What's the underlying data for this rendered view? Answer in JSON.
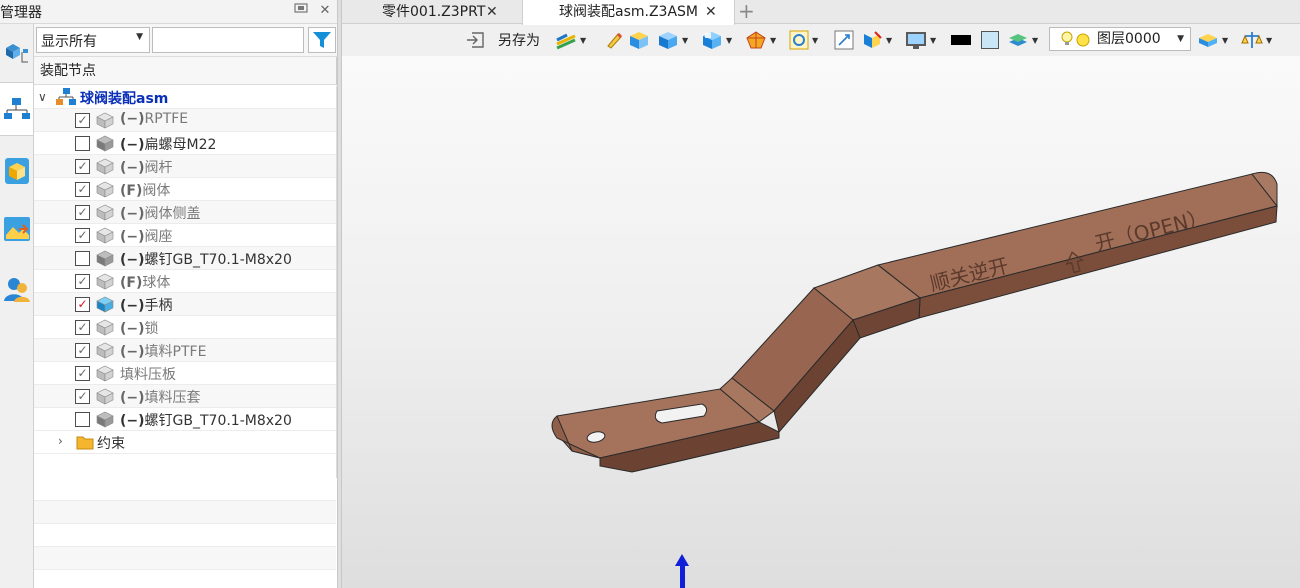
{
  "manager": {
    "title": "管理器",
    "pin_icon": "pin-icon",
    "close_icon": "close-icon"
  },
  "side_tabs": [
    "assembly-manager-icon",
    "history-tree-icon",
    "part-view-icon",
    "image-view-icon",
    "user-roles-icon"
  ],
  "filter": {
    "selected": "显示所有",
    "search_value": "",
    "filter_icon": "funnel-icon"
  },
  "tree": {
    "column_header": "装配节点",
    "root_label": "球阀装配asm",
    "items": [
      {
        "checked": true,
        "prefix": "(−)",
        "name": "RPTFE",
        "dim": true,
        "icon_dark": false
      },
      {
        "checked": false,
        "prefix": "(−)",
        "name": "扁螺母M22",
        "dim": false,
        "icon_dark": true
      },
      {
        "checked": true,
        "prefix": "(−)",
        "name": "阀杆",
        "dim": true,
        "icon_dark": false
      },
      {
        "checked": true,
        "prefix": "(F)",
        "name": "阀体",
        "dim": true,
        "icon_dark": false
      },
      {
        "checked": true,
        "prefix": "(−)",
        "name": "阀体侧盖",
        "dim": true,
        "icon_dark": false
      },
      {
        "checked": true,
        "prefix": "(−)",
        "name": "阀座",
        "dim": true,
        "icon_dark": false
      },
      {
        "checked": false,
        "prefix": "(−)",
        "name": "螺钉GB_T70.1-M8x20",
        "dim": false,
        "icon_dark": true
      },
      {
        "checked": true,
        "prefix": "(F)",
        "name": "球体",
        "dim": true,
        "icon_dark": false
      },
      {
        "checked": true,
        "prefix": "(−)",
        "name": "手柄",
        "dim": false,
        "icon_dark": false,
        "active": true
      },
      {
        "checked": true,
        "prefix": "(−)",
        "name": "锁",
        "dim": true,
        "icon_dark": false
      },
      {
        "checked": true,
        "prefix": "(−)",
        "name": "填料PTFE",
        "dim": true,
        "icon_dark": false
      },
      {
        "checked": true,
        "prefix": "",
        "name": "填料压板",
        "dim": true,
        "icon_dark": false
      },
      {
        "checked": true,
        "prefix": "(−)",
        "name": "填料压套",
        "dim": true,
        "icon_dark": false
      },
      {
        "checked": false,
        "prefix": "(−)",
        "name": "螺钉GB_T70.1-M8x20",
        "dim": false,
        "icon_dark": true
      }
    ],
    "constraints_label": "约束"
  },
  "doc_tabs": [
    {
      "label": "零件001.Z3PRT",
      "active": false
    },
    {
      "label": "球阀装配asm.Z3ASM",
      "active": true
    }
  ],
  "toolbar": {
    "save_as_label": "另存为",
    "layer_label": "图层0000",
    "icons": [
      "import-icon",
      "render-mode-icon",
      "pen-icon",
      "solid-view-icon",
      "view-cube-icon",
      "section-view-icon",
      "filter-cube-icon",
      "zoom-fit-icon",
      "fit-window-icon",
      "orient-icon",
      "display-icon",
      "color-swatch-icon",
      "background-swatch-icon",
      "layer-stack-icon",
      "lightbulb-icon",
      "layer-manager-icon",
      "measure-icon"
    ]
  },
  "viewport": {
    "engraving_left": "顺关逆开",
    "engraving_right": "开（OPEN）",
    "part_color": "#8f6452",
    "triad_color": "#1020d8"
  }
}
